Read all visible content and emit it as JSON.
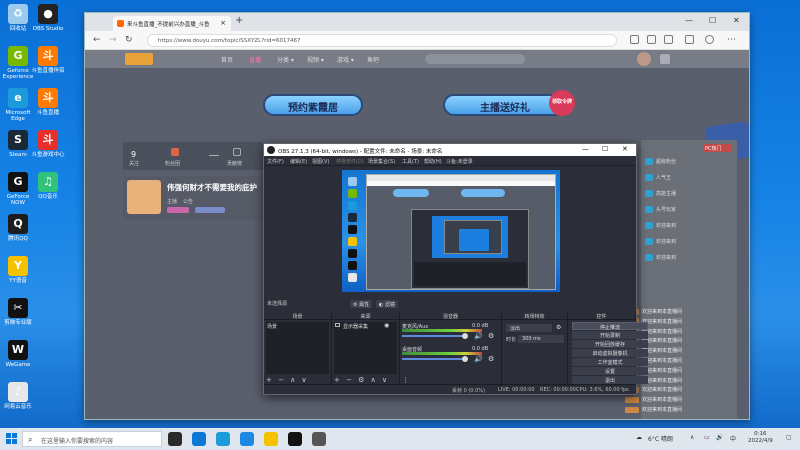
{
  "desktop": {
    "icons": [
      {
        "label": "回收站",
        "color": "#9cc9ee",
        "glyph": "♻"
      },
      {
        "label": "Geforce Experience",
        "color": "#76b900",
        "glyph": "G"
      },
      {
        "label": "Microsoft Edge",
        "color": "#1c9bdb",
        "glyph": "e"
      },
      {
        "label": "Steam",
        "color": "#1b2838",
        "glyph": "S"
      },
      {
        "label": "GeForce NOW",
        "color": "#111",
        "glyph": "G"
      },
      {
        "label": "腾讯QQ",
        "color": "#1d1d1d",
        "glyph": "Q"
      },
      {
        "label": "YY语音",
        "color": "#f5c200",
        "glyph": "Y"
      },
      {
        "label": "剪映专业版",
        "color": "#111",
        "glyph": "✂"
      },
      {
        "label": "WeGame",
        "color": "#111",
        "glyph": "W"
      },
      {
        "label": "网易云音乐",
        "color": "#e7e7e7",
        "glyph": "♪"
      }
    ],
    "icons_col2": [
      {
        "label": "OBS Studio",
        "color": "#222",
        "glyph": "●"
      },
      {
        "label": "斗鱼直播伴侣",
        "color": "#ff7a00",
        "glyph": "斗"
      },
      {
        "label": "斗鱼直播",
        "color": "#ff7a00",
        "glyph": "斗"
      },
      {
        "label": "斗鱼游戏中心",
        "color": "#e8302a",
        "glyph": "斗"
      },
      {
        "label": "QQ音乐",
        "color": "#31c27c",
        "glyph": "♫"
      }
    ]
  },
  "browser": {
    "tab_title": "来斗鱼直播_不提前兴办直播_斗鱼",
    "new_tab": "+",
    "min": "—",
    "max": "☐",
    "close": "✕",
    "url": "https://www.douyu.com/topic/SSXYZL?rid=6017467",
    "nav": {
      "back": "←",
      "forward": "→",
      "refresh": "↻",
      "home": "⌂"
    },
    "site_nav": [
      "首页",
      "直播",
      "分类 ▾",
      "视频 ▾",
      "游戏 ▾",
      "鱼吧"
    ],
    "banners": [
      "预约紫霞居",
      "主播送好礼"
    ],
    "banner_badge": "领取令牌",
    "stream_stats": [
      "9",
      "关注",
      "粉丝团",
      "贡献榜"
    ],
    "card_title": "伟强何财才不需要我的庇护",
    "card_sub": [
      "主播",
      "公告"
    ],
    "right_panel_title": "PC热门",
    "right_rows": [
      "超级粉丝",
      "人气王",
      "高能主播",
      "头号玩家",
      "欢迎来到",
      "欢迎来到",
      "欢迎来到"
    ],
    "chat_rows": [
      "欢迎来到本直播间",
      "欢迎来到本直播间",
      "欢迎来到本直播间",
      "欢迎来到本直播间",
      "欢迎来到本直播间",
      "欢迎来到本直播间",
      "欢迎来到本直播间",
      "欢迎来到本直播间",
      "欢迎来到本直播间",
      "欢迎来到本直播间",
      "欢迎来到本直播间"
    ]
  },
  "obs": {
    "title": "OBS 27.1.3 (64-bit, windows) - 配置文件: 未命名 - 场景: 未命名",
    "menu": [
      "文件(F)",
      "编辑(E)",
      "视图(V)",
      "停靠部件(D)",
      "场景集合(S)",
      "工具(T)",
      "帮助(H)",
      "斗鱼:未登录"
    ],
    "no_source": "未选择源",
    "btn_props": "属性",
    "btn_filters": "滤镜",
    "docks": {
      "scenes": "场景",
      "sources": "来源",
      "mixer": "混音器",
      "transitions": "转场特效",
      "controls": "控件"
    },
    "scene_item": "场景",
    "source_item": "显示器采集",
    "mixer": [
      {
        "name": "麦克风/Aux",
        "db": "0.0 dB"
      },
      {
        "name": "桌面音频",
        "db": "0.0 dB"
      }
    ],
    "transition": {
      "type": "淡出",
      "duration_label": "时长",
      "duration": "300 ms"
    },
    "controls": [
      "停止推流",
      "开始录制",
      "开始回放缓存",
      "启动虚拟摄像机",
      "工作室模式",
      "设置",
      "退出"
    ],
    "status": {
      "drop": "丢帧 0 (0.0%)",
      "live": "LIVE: 00:00:00",
      "rec": "REC: 00:00:00",
      "cpu": "CPU: 3.6%, 60.00 fps"
    }
  },
  "taskbar": {
    "search_placeholder": "在这里输入你要搜索的内容",
    "weather": "6°C 晴朗",
    "time": "0:16",
    "date": "2022/4/9",
    "apps": [
      "#2a2a2a",
      "#0a78d4",
      "#1c9bdb",
      "#1e88e5",
      "#f5c200",
      "#111",
      "#555"
    ]
  }
}
